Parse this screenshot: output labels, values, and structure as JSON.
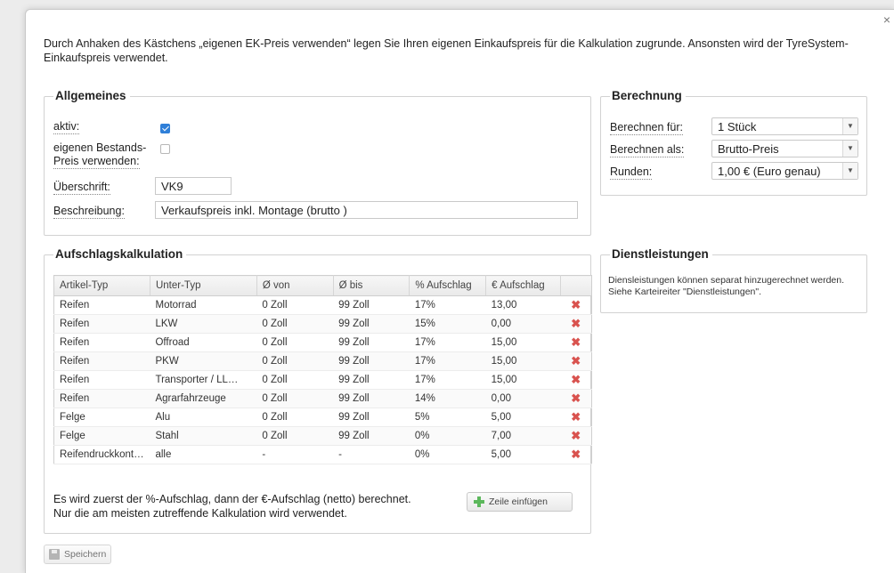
{
  "dialog": {
    "close_glyph": "×",
    "intro": "Durch Anhaken des Kästchens „eigenen EK-Preis verwenden“ legen Sie Ihren eigenen Einkaufspreis für die Kalkulation zugrunde. Ansonsten wird der TyreSystem-Einkaufspreis verwendet."
  },
  "allgemeines": {
    "title": "Allgemeines",
    "aktiv_label": "aktiv:",
    "aktiv_checked": true,
    "eigener_preis_label_1": "eigenen Bestands-",
    "eigener_preis_label_2": "Preis verwenden:",
    "eigener_preis_checked": false,
    "ueberschrift_label": "Überschrift:",
    "ueberschrift_value": "VK9",
    "beschreibung_label": "Beschreibung:",
    "beschreibung_value": "Verkaufspreis inkl. Montage (brutto )"
  },
  "berechnung": {
    "title": "Berechnung",
    "fuer_label": "Berechnen für:",
    "fuer_value": "1 Stück",
    "als_label": "Berechnen als:",
    "als_value": "Brutto-Preis",
    "runden_label": "Runden:",
    "runden_value": "1,00 € (Euro genau)"
  },
  "aufschlag": {
    "title": "Aufschlagskalkulation",
    "columns": [
      "Artikel-Typ",
      "Unter-Typ",
      "Ø von",
      "Ø bis",
      "% Aufschlag",
      "€ Aufschlag"
    ],
    "rows": [
      [
        "Reifen",
        "Motorrad",
        "0 Zoll",
        "99 Zoll",
        "17%",
        "13,00"
      ],
      [
        "Reifen",
        "LKW",
        "0 Zoll",
        "99 Zoll",
        "15%",
        "0,00"
      ],
      [
        "Reifen",
        "Offroad",
        "0 Zoll",
        "99 Zoll",
        "17%",
        "15,00"
      ],
      [
        "Reifen",
        "PKW",
        "0 Zoll",
        "99 Zoll",
        "17%",
        "15,00"
      ],
      [
        "Reifen",
        "Transporter / LL…",
        "0 Zoll",
        "99 Zoll",
        "17%",
        "15,00"
      ],
      [
        "Reifen",
        "Agrarfahrzeuge",
        "0 Zoll",
        "99 Zoll",
        "14%",
        "0,00"
      ],
      [
        "Felge",
        "Alu",
        "0 Zoll",
        "99 Zoll",
        "5%",
        "5,00"
      ],
      [
        "Felge",
        "Stahl",
        "0 Zoll",
        "99 Zoll",
        "0%",
        "7,00"
      ],
      [
        "Reifendruckkont…",
        "alle",
        "-",
        "-",
        "0%",
        "5,00"
      ]
    ],
    "delete_glyph": "✖",
    "note_1": "Es wird zuerst der %-Aufschlag, dann der €-Aufschlag (netto) berechnet.",
    "note_2": "Nur die am meisten zutreffende Kalkulation wird verwendet.",
    "add_row_label": "Zeile einfügen"
  },
  "dienstleistungen": {
    "title": "Dienstleistungen",
    "text_1": "Diensleistungen können separat hinzugerechnet werden.",
    "text_2": "Siehe Karteireiter \"Dienstleistungen\"."
  },
  "footer": {
    "save_label": "Speichern"
  },
  "colors": {
    "accent": "#2f7fd8",
    "delete": "#d9534f",
    "add": "#5cb85c"
  }
}
